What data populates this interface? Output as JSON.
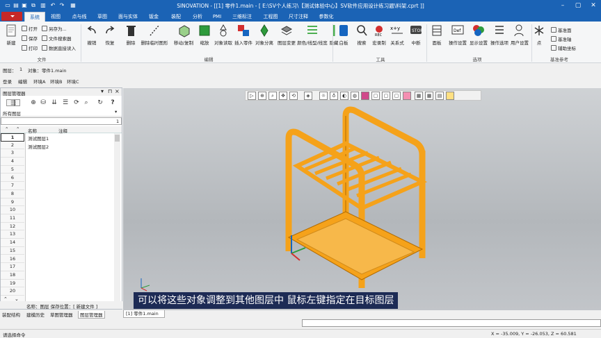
{
  "title": "SINOVATION - [[1] 零件1.main - [ E:\\SV个人练习\\【测试体验中心】SV软件应用设计练习题\\料架.cprt ]]",
  "quick_access": [
    "new-icon",
    "open-icon",
    "save-icon",
    "undo-icon",
    "redo-icon",
    "copy-icon",
    "paste-icon",
    "print-icon"
  ],
  "menu": {
    "tabs": [
      "系统",
      "视图",
      "点与线",
      "草图",
      "面与实体",
      "钣金",
      "装配",
      "分析",
      "PMI",
      "三维标注",
      "工程图",
      "尺寸注释",
      "参数化"
    ],
    "active": 0
  },
  "ribbon": {
    "new": "新建",
    "file_small": [
      "打开",
      "另存为...",
      "保存",
      "文件搜索器",
      "打印",
      "数据直接读入"
    ],
    "edit_buttons": [
      "撤销",
      "恢复",
      "删除",
      "删除临时图形",
      "移动/复制",
      "缩放",
      "对象读取",
      "插入零件",
      "对象分离",
      "图层变更",
      "颜色/线型/线宽",
      "隐藏"
    ],
    "tool_buttons": [
      "白板",
      "搜索",
      "宏录制",
      "关系式",
      "中断"
    ],
    "option_buttons": [
      "面板",
      "操作设置",
      "显示设置",
      "操作选项",
      "用户设置"
    ],
    "ref_buttons": [
      "点",
      "基准面",
      "基准轴",
      "辅助坐标"
    ],
    "groups": {
      "file": "文件",
      "edit": "编辑",
      "tools": "工具",
      "options": "选项",
      "ref": "基准参考"
    }
  },
  "info": {
    "layer_label": "图层：",
    "layer_value": "1",
    "object_label": "对象：",
    "object_value": "零件1.main"
  },
  "env": [
    "登录",
    "编辑",
    "环境A",
    "环境B",
    "环境C"
  ],
  "panel": {
    "title": "图层管理器",
    "filter": "所有图层",
    "input_value": "1",
    "headers": {
      "name": "名称",
      "comment": "注释"
    },
    "rows": [
      "1",
      "2",
      "3",
      "4",
      "5",
      "6",
      "7",
      "8",
      "9",
      "10",
      "11",
      "12",
      "13",
      "14",
      "15",
      "16",
      "17",
      "18",
      "19",
      "20"
    ],
    "layers": [
      "测试图层1",
      "测试图层2"
    ],
    "footer": "名称：图层   保存位置：[  新建文件  ]",
    "bottom_tabs": [
      "装配结构",
      "建模历史",
      "草图管理器",
      "图层管理器"
    ]
  },
  "viewport": {
    "doc_tab": "[1] 零件1.main",
    "subtitle": "可以将这些对象调整到其他图层中 鼠标左键指定在目标图层"
  },
  "status": {
    "left": "请选择命令",
    "coords": "X = -35.009, Y = -26.053, Z = 60.581"
  },
  "colors": {
    "accent": "#1b63b5",
    "part": "#f5a21a"
  }
}
